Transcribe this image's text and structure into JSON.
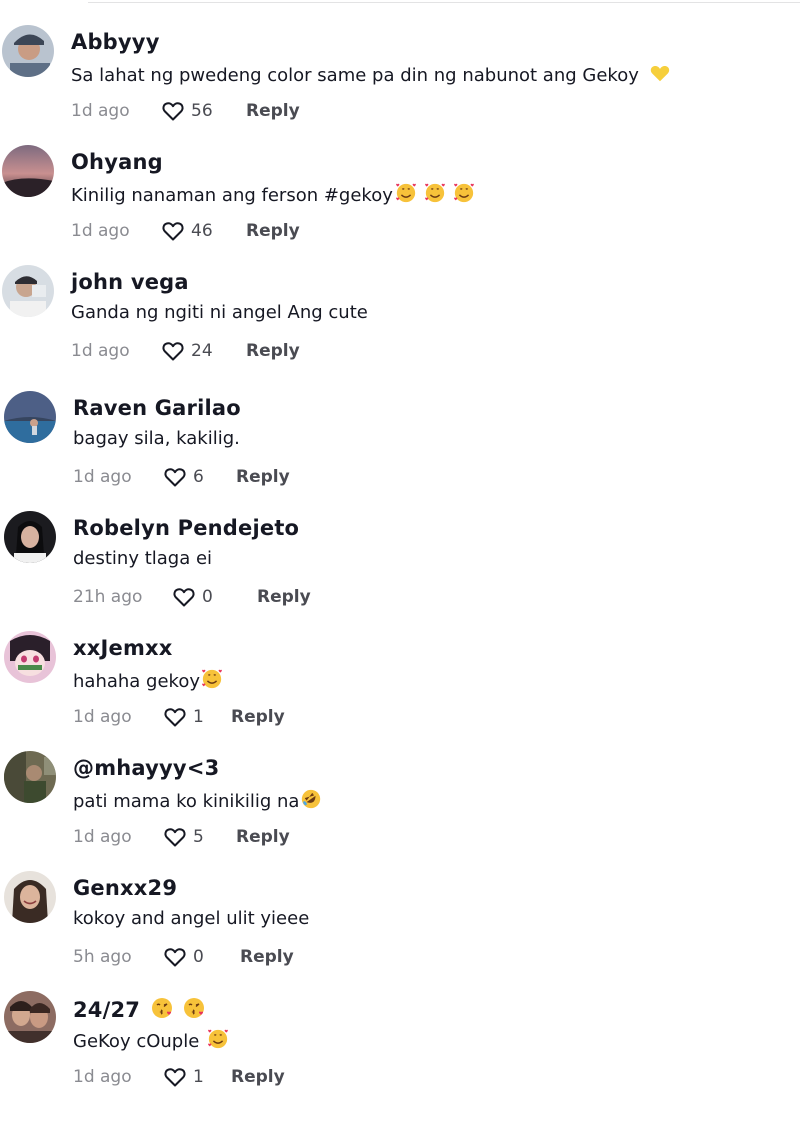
{
  "colors": {
    "text": "#161823",
    "muted": "#8a8b91",
    "secondary": "#4a4b52",
    "emoji_face": "#f7c23a",
    "heart_emoji": "#f6cf3c"
  },
  "comments": [
    {
      "username": "Abbyyy",
      "text": "Sa lahat ng pwedeng color same pa din ng nabunot ang Gekoy",
      "text_emojis": [
        "yellow-heart"
      ],
      "time": "1d ago",
      "likes": "56",
      "reply_label": "Reply",
      "avatar": "avatar-photo-person-cap"
    },
    {
      "username": "Ohyang",
      "text": "Kinilig nanaman ang ferson #gekoy",
      "text_emojis": [
        "smiling-face-with-hearts",
        "smiling-face-with-hearts",
        "smiling-face-with-hearts"
      ],
      "time": "1d ago",
      "likes": "46",
      "reply_label": "Reply",
      "avatar": "avatar-photo-sunset"
    },
    {
      "username": "john vega",
      "text": "Ganda ng ngiti ni angel Ang cute",
      "text_emojis": [],
      "time": "1d ago",
      "likes": "24",
      "reply_label": "Reply",
      "avatar": "avatar-photo-person"
    },
    {
      "username": "Raven Garilao",
      "text": "bagay sila, kakilig.",
      "text_emojis": [],
      "time": "1d ago",
      "likes": "6",
      "reply_label": "Reply",
      "avatar": "avatar-photo-pool"
    },
    {
      "username": "Robelyn Pendejeto",
      "text": "destiny tlaga ei",
      "text_emojis": [],
      "time": "21h ago",
      "likes": "0",
      "reply_label": "Reply",
      "avatar": "avatar-photo-woman-dark"
    },
    {
      "username": "xxJemxx",
      "text": "hahaha gekoy",
      "text_emojis": [
        "smiling-face-with-hearts"
      ],
      "time": "1d ago",
      "likes": "1",
      "reply_label": "Reply",
      "avatar": "avatar-anime-pink"
    },
    {
      "username": "@mhayyy<3",
      "text": "pati mama ko kinikilig na",
      "text_emojis": [
        "rolling-on-floor-laughing"
      ],
      "time": "1d ago",
      "likes": "5",
      "reply_label": "Reply",
      "avatar": "avatar-photo-indoor"
    },
    {
      "username": "Genxx29",
      "text": "kokoy and angel ulit yieee",
      "text_emojis": [],
      "time": "5h ago",
      "likes": "0",
      "reply_label": "Reply",
      "avatar": "avatar-photo-woman-smile"
    },
    {
      "username": "24/27",
      "username_emojis": [
        "face-blowing-kiss",
        "face-blowing-kiss"
      ],
      "text": "GeKoy cOuple",
      "text_emojis": [
        "smiling-face-with-hearts"
      ],
      "time": "1d ago",
      "likes": "1",
      "reply_label": "Reply",
      "avatar": "avatar-photo-couple"
    }
  ]
}
